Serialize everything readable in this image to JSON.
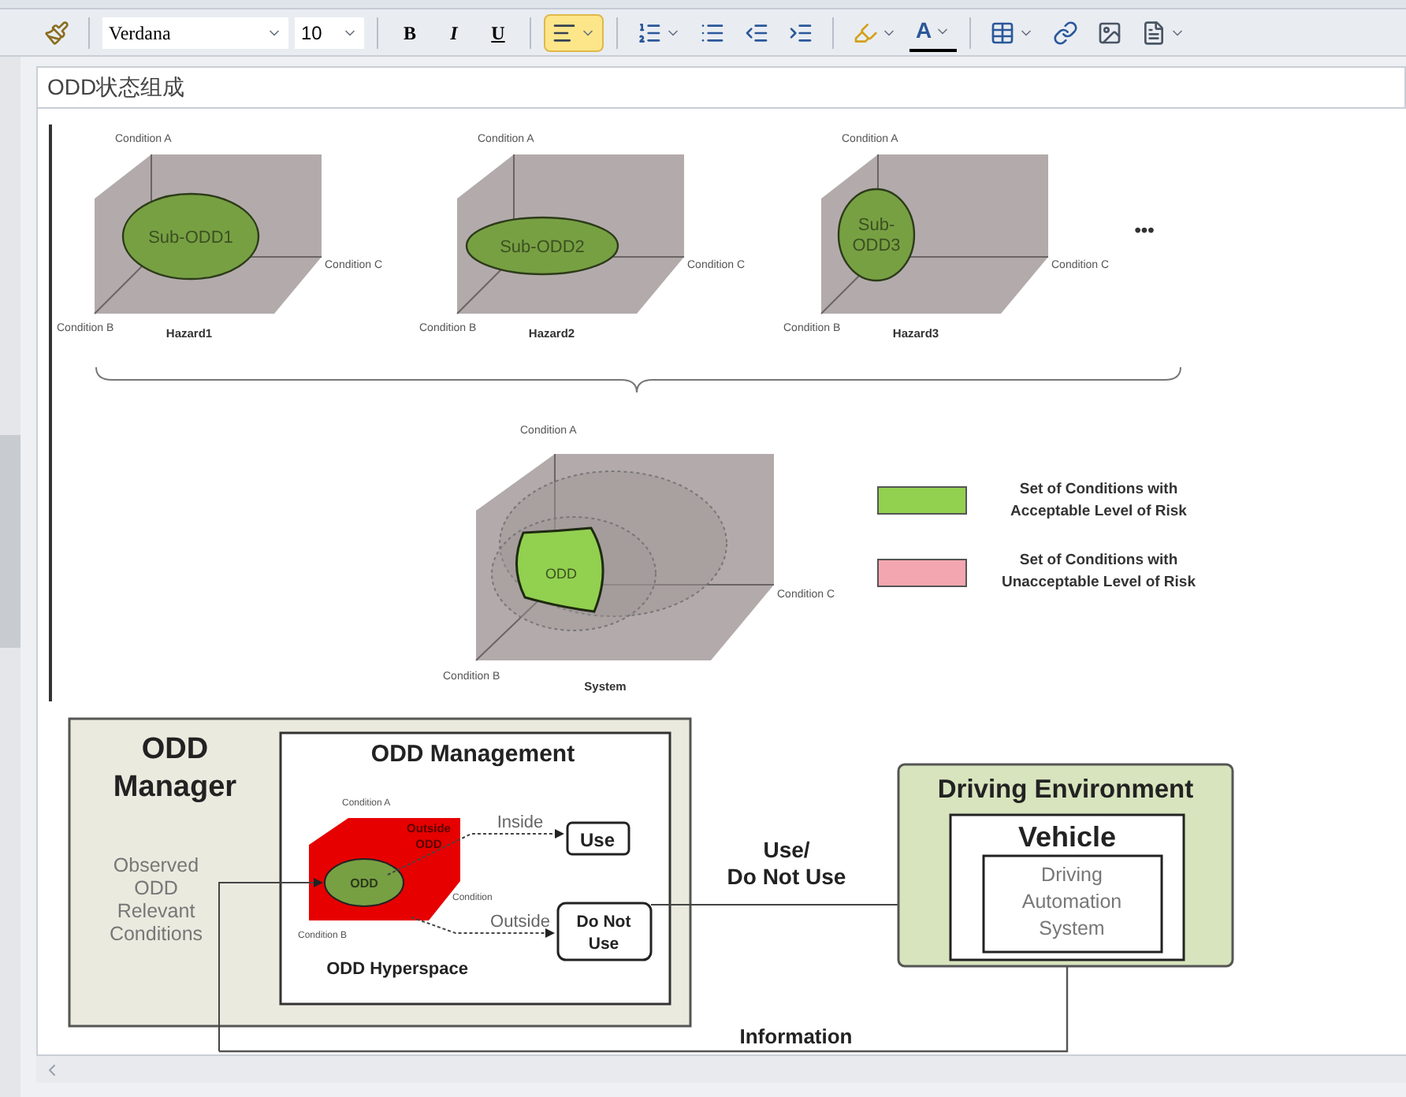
{
  "toolbar": {
    "groups": [
      [
        {
          "kind": "brush"
        }
      ],
      [
        {
          "kind": "font",
          "value": "Verdana"
        },
        {
          "kind": "size",
          "value": "10"
        }
      ],
      [
        {
          "kind": "bold",
          "text": "B",
          "selected": false
        },
        {
          "kind": "italic",
          "text": "I",
          "selected": false
        },
        {
          "kind": "underline",
          "text": "U",
          "selected": false
        }
      ],
      [
        {
          "kind": "align",
          "selected": true
        }
      ],
      [
        {
          "kind": "numbered"
        },
        {
          "kind": "bulleted"
        },
        {
          "kind": "outdent"
        },
        {
          "kind": "indent"
        }
      ],
      [
        {
          "kind": "highlight"
        },
        {
          "kind": "font_color",
          "text": "A"
        }
      ],
      [
        {
          "kind": "table"
        },
        {
          "kind": "link"
        },
        {
          "kind": "image"
        },
        {
          "kind": "insert"
        }
      ]
    ]
  },
  "note_title": "ODD状态组成",
  "hazard_figure": {
    "cubes": [
      {
        "kind": "ellipse",
        "label_lines": [
          "Sub-ODD1"
        ],
        "caption": "Hazard1",
        "axes": [
          "Condition A",
          "Condition B",
          "Condition C"
        ]
      },
      {
        "kind": "flat",
        "label_lines": [
          "Sub-ODD2"
        ],
        "caption": "Hazard2",
        "axes": [
          "Condition A",
          "Condition B",
          "Condition C"
        ]
      },
      {
        "kind": "round",
        "label_lines": [
          "Sub-",
          "ODD3"
        ],
        "caption": "Hazard3",
        "axes": [
          "Condition A",
          "Condition B",
          "Condition C"
        ]
      }
    ],
    "ellipsis": "•••",
    "system": {
      "label": "ODD",
      "caption": "System",
      "axes": [
        "Condition A",
        "Condition B",
        "Condition C"
      ]
    },
    "legend": [
      {
        "color": "#92d050",
        "lines": [
          "Set of Conditions with",
          "Acceptable Level of Risk"
        ]
      },
      {
        "color": "#f4a6b0",
        "lines": [
          "Set of Conditions with",
          "Unacceptable Level of Risk"
        ]
      }
    ]
  },
  "management_figure": {
    "manager_title_lines": [
      "ODD",
      "Manager"
    ],
    "observed_lines": [
      "Observed",
      "ODD",
      "Relevant",
      "Conditions"
    ],
    "management_title": "ODD Management",
    "hyperspace_axes": [
      "Condition A",
      "Condition B",
      "Condition"
    ],
    "outside_region_lines": [
      "Outside",
      "ODD"
    ],
    "odd_label": "ODD",
    "inside_label": "Inside",
    "outside_label": "Outside",
    "use_box": "Use",
    "do_not_use_lines": [
      "Do Not",
      "Use"
    ],
    "hyperspace_caption": "ODD Hyperspace",
    "decision_lines": [
      "Use/",
      "Do Not Use"
    ],
    "environment_title": "Driving Environment",
    "vehicle_title": "Vehicle",
    "system_lines": [
      "Driving",
      "Automation",
      "System"
    ],
    "information_label": "Information"
  }
}
